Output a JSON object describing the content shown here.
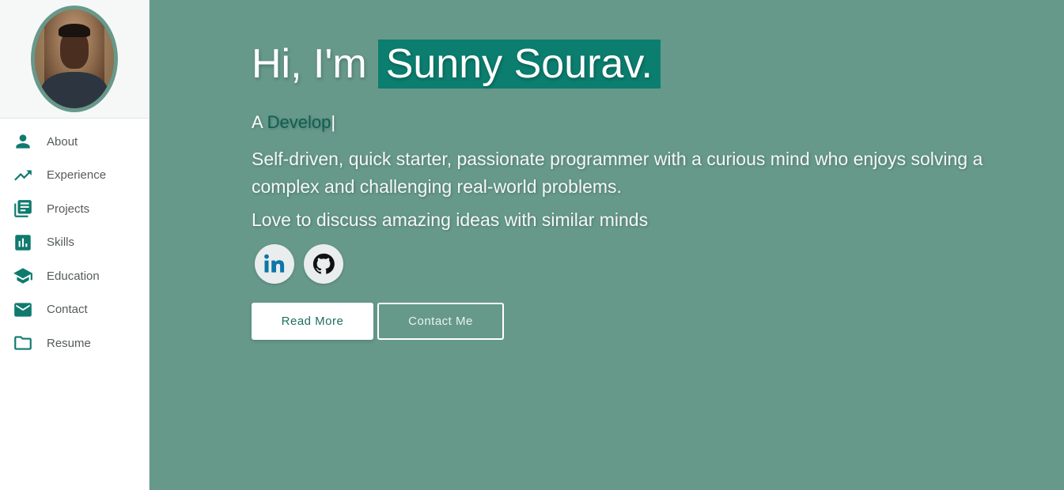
{
  "sidebar": {
    "avatar_alt": "profile photo",
    "items": [
      {
        "label": "About",
        "icon": "person-icon"
      },
      {
        "label": "Experience",
        "icon": "trending-up-icon"
      },
      {
        "label": "Projects",
        "icon": "library-books-icon"
      },
      {
        "label": "Skills",
        "icon": "bar-chart-icon"
      },
      {
        "label": "Education",
        "icon": "graduation-cap-icon"
      },
      {
        "label": "Contact",
        "icon": "mail-icon"
      },
      {
        "label": "Resume",
        "icon": "folder-icon"
      }
    ]
  },
  "hero": {
    "greeting": "Hi, I'm",
    "name": "Sunny Sourav.",
    "role_prefix": "A",
    "role_typed": "Develop",
    "role_cursor": "|",
    "bio": "Self-driven, quick starter, passionate programmer with a curious mind who enjoys solving a complex and challenging real-world problems.",
    "tagline": "Love to discuss amazing ideas with similar minds",
    "socials": [
      {
        "name": "LinkedIn",
        "icon": "linkedin-icon"
      },
      {
        "name": "GitHub",
        "icon": "github-icon"
      }
    ],
    "primary_button": "Read More",
    "secondary_button": "Contact Me"
  },
  "colors": {
    "accent": "#0f7a6e",
    "hero_bg": "#66998a",
    "name_highlight": "#0c7e6f",
    "typed_text": "#0e5f54"
  }
}
